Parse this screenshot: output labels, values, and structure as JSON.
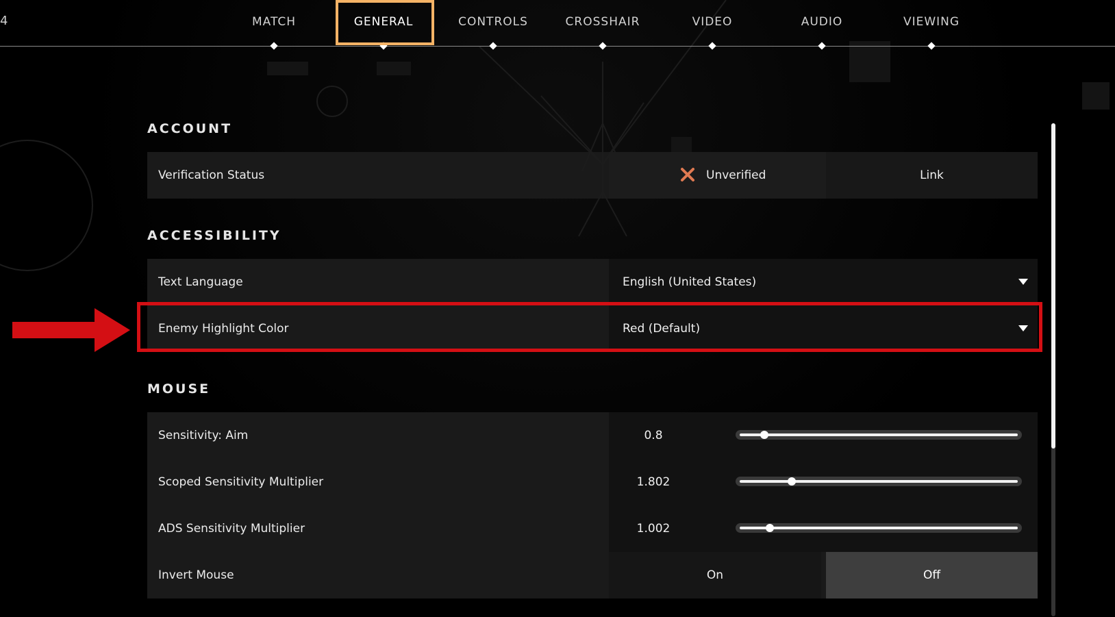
{
  "nav": {
    "tabs": [
      {
        "label": "MATCH",
        "active": false
      },
      {
        "label": "GENERAL",
        "active": true
      },
      {
        "label": "CONTROLS",
        "active": false
      },
      {
        "label": "CROSSHAIR",
        "active": false
      },
      {
        "label": "VIDEO",
        "active": false
      },
      {
        "label": "AUDIO",
        "active": false
      },
      {
        "label": "VIEWING",
        "active": false
      }
    ],
    "active_highlight_color": "#f5b366"
  },
  "sections": {
    "account": {
      "title": "ACCOUNT",
      "verification": {
        "label": "Verification Status",
        "status_icon": "x-icon",
        "status_icon_color": "#e07a52",
        "status_text": "Unverified",
        "action_label": "Link"
      }
    },
    "accessibility": {
      "title": "ACCESSIBILITY",
      "text_language": {
        "label": "Text Language",
        "value": "English (United States)"
      },
      "enemy_highlight_color": {
        "label": "Enemy Highlight Color",
        "value": "Red (Default)"
      }
    },
    "mouse": {
      "title": "MOUSE",
      "sensitivity_aim": {
        "label": "Sensitivity: Aim",
        "value": "0.8",
        "fraction": 0.08
      },
      "scoped_sensitivity": {
        "label": "Scoped Sensitivity Multiplier",
        "value": "1.802",
        "fraction": 0.18
      },
      "ads_sensitivity": {
        "label": "ADS Sensitivity Multiplier",
        "value": "1.002",
        "fraction": 0.1
      },
      "invert_mouse": {
        "label": "Invert Mouse",
        "on_label": "On",
        "off_label": "Off",
        "selected": "Off"
      }
    }
  },
  "annotation": {
    "highlight_color": "#d40f14"
  },
  "scroll": {
    "fraction_visible": 0.66
  }
}
